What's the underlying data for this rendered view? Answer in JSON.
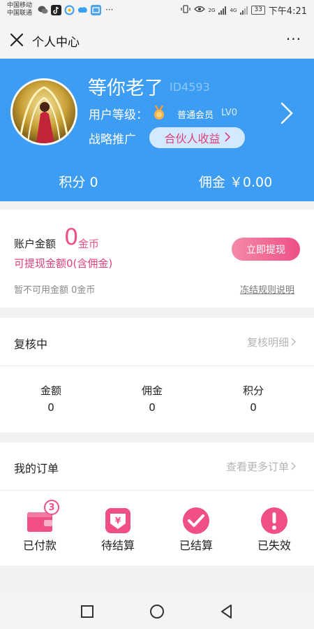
{
  "status_bar": {
    "carrier_1": "中国移动",
    "carrier_2": "中国联通",
    "dots": "···",
    "battery": "33",
    "signal_1": "2G",
    "signal_2": "4G",
    "time": "下午4:21"
  },
  "titlebar": {
    "title": "个人中心",
    "more": "···"
  },
  "profile": {
    "nickname": "等你老了",
    "id": "ID4593",
    "level_label": "用户等级：",
    "level_name": "普通会员",
    "level_code": "LV0",
    "strategy_label": "战略推广",
    "partner_button": "合伙人收益",
    "points": "积分 0",
    "commission": "佣金 ￥0.00"
  },
  "account": {
    "label": "账户金额",
    "amount": "0",
    "unit": "金币",
    "withdrawable": "可提现金额0(含佣金)",
    "withdraw_button": "立即提现",
    "unavailable": "暂不可用金额 0金币",
    "freeze_link": "冻结规则说明"
  },
  "review": {
    "title": "复核中",
    "link": "复核明细",
    "columns": [
      {
        "label": "金额",
        "value": "0"
      },
      {
        "label": "佣金",
        "value": "0"
      },
      {
        "label": "积分",
        "value": "0"
      }
    ]
  },
  "orders": {
    "title": "我的订单",
    "link": "查看更多订单",
    "items": [
      {
        "label": "已付款",
        "icon": "wallet-icon",
        "badge": "3"
      },
      {
        "label": "待结算",
        "icon": "yen-download-icon"
      },
      {
        "label": "已结算",
        "icon": "check-circle-icon"
      },
      {
        "label": "已失效",
        "icon": "exclamation-circle-icon"
      }
    ]
  },
  "colors": {
    "header_blue": "#3d9df3",
    "accent_pink": "#ef4f84"
  }
}
